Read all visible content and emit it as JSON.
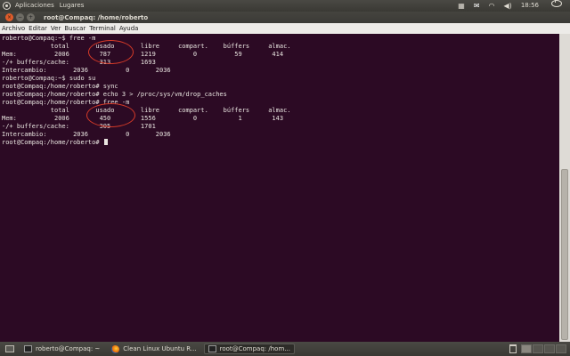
{
  "top_panel": {
    "menus": [
      "Aplicaciones",
      "Lugares"
    ],
    "clock": "18:56"
  },
  "window": {
    "title": "root@Compaq: /home/roberto"
  },
  "menubar": [
    "Archivo",
    "Editar",
    "Ver",
    "Buscar",
    "Terminal",
    "Ayuda"
  ],
  "terminal_lines": [
    "roberto@Compaq:~$ free -m",
    "             total       usado       libre     compart.    búffers     almac.",
    "Mem:          2006        787        1219          0          59        414",
    "-/+ buffers/cache:        313        1693",
    "Intercambio:       2036          0       2036",
    "roberto@Compaq:~$ sudo su",
    "root@Compaq:/home/roberto# sync",
    "root@Compaq:/home/roberto# echo 3 > /proc/sys/vm/drop_caches",
    "root@Compaq:/home/roberto# free -m",
    "             total       usado       libre     compart.    búffers     almac.",
    "Mem:          2006        450        1556          0           1        143",
    "-/+ buffers/cache:        305        1701",
    "Intercambio:       2036          0       2036",
    "root@Compaq:/home/roberto# "
  ],
  "taskbar": {
    "tasks": [
      {
        "label": "roberto@Compaq: ~",
        "icon": "terminal-icon"
      },
      {
        "label": "Clean Linux Ubuntu R...",
        "icon": "firefox-icon"
      },
      {
        "label": "root@Compaq: /hom...",
        "icon": "terminal-icon"
      }
    ]
  },
  "colors": {
    "terminal_bg": "#2c0a24",
    "annotation_circle": "#d43a28"
  }
}
